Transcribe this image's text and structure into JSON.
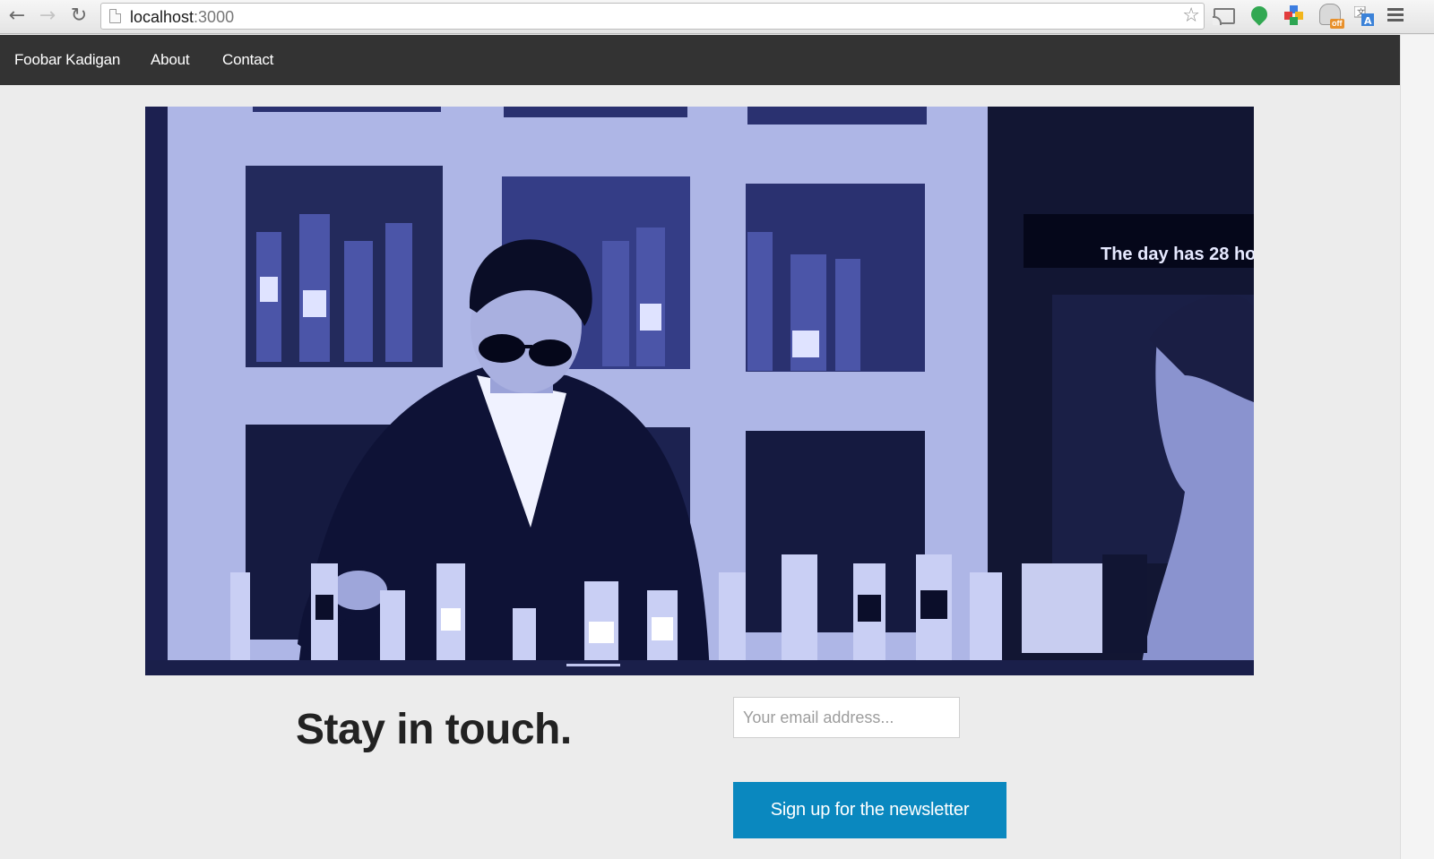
{
  "browser": {
    "url_host": "localhost",
    "url_port": ":3000"
  },
  "navbar": {
    "brand": "Foobar Kadigan",
    "links": [
      "About",
      "Contact"
    ]
  },
  "hero": {
    "image_description_sign": "The day has 28 ho",
    "tint_color": "#3a4598"
  },
  "signup": {
    "headline": "Stay in touch.",
    "email_placeholder": "Your email address...",
    "button_label": "Sign up for the newsletter",
    "button_color": "#0a88bf"
  },
  "extension_badge": "off"
}
